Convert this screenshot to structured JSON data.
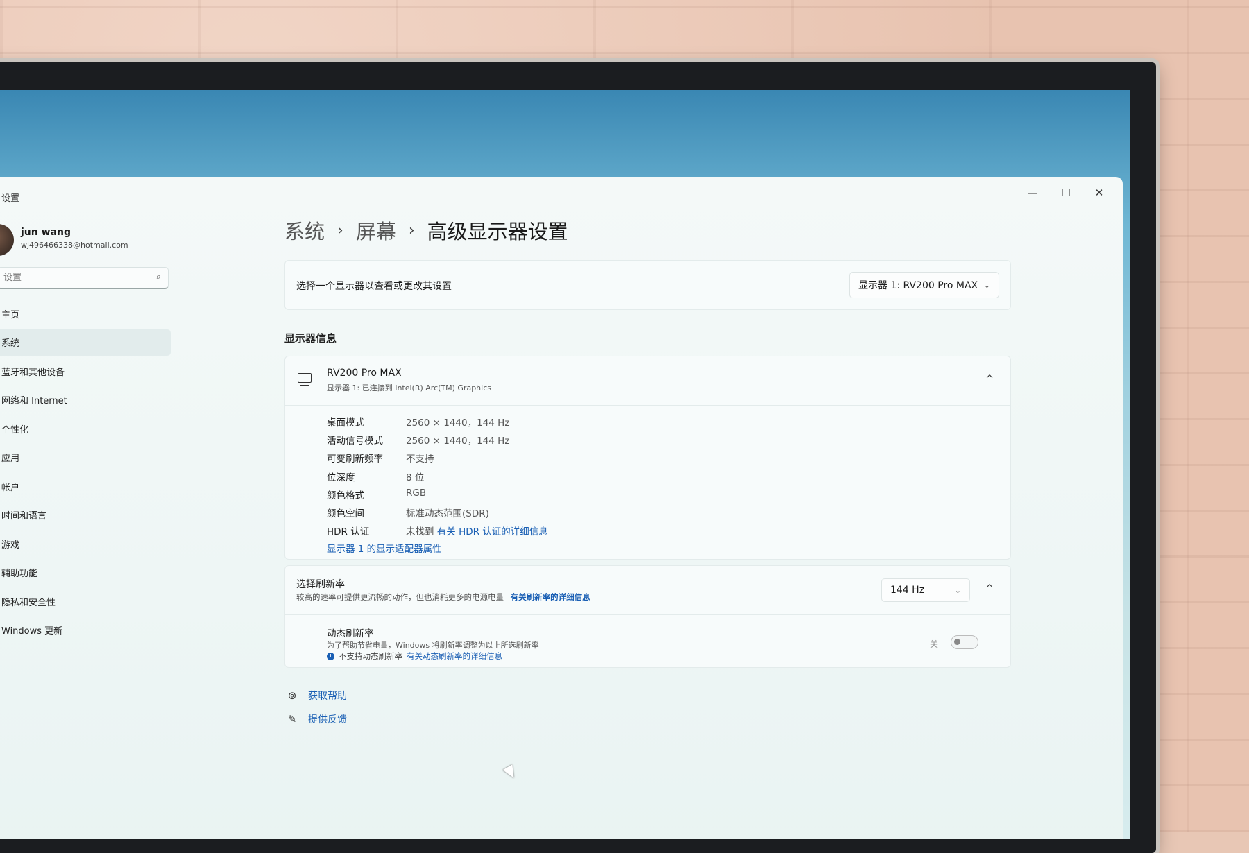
{
  "window": {
    "title": "设置",
    "controls": {
      "minimize": "—",
      "maximize": "☐",
      "close": "✕"
    }
  },
  "user": {
    "name": "jun wang",
    "email": "wj496466338@hotmail.com"
  },
  "search": {
    "placeholder": "设置",
    "icon": "search-icon"
  },
  "sidebar": {
    "items": [
      {
        "label": "主页"
      },
      {
        "label": "系统",
        "active": true
      },
      {
        "label": "蓝牙和其他设备"
      },
      {
        "label": "网络和 Internet"
      },
      {
        "label": "个性化"
      },
      {
        "label": "应用"
      },
      {
        "label": "帐户"
      },
      {
        "label": "时间和语言"
      },
      {
        "label": "游戏"
      },
      {
        "label": "辅助功能"
      },
      {
        "label": "隐私和安全性"
      },
      {
        "label": "Windows 更新"
      }
    ]
  },
  "breadcrumb": {
    "system": "系统",
    "screen": "屏幕",
    "current": "高级显示器设置",
    "separator": "›"
  },
  "display_picker": {
    "label": "选择一个显示器以查看或更改其设置",
    "value": "显示器 1: RV200 Pro MAX"
  },
  "section_title": "显示器信息",
  "display_info": {
    "name": "RV200 Pro MAX",
    "subtitle": "显示器 1: 已连接到 Intel(R) Arc(TM) Graphics",
    "rows": [
      {
        "key": "桌面模式",
        "value": "2560 × 1440，144 Hz"
      },
      {
        "key": "活动信号模式",
        "value": "2560 × 1440，144 Hz"
      },
      {
        "key": "可变刷新频率",
        "value": "不支持"
      },
      {
        "key": "位深度",
        "value": "8 位"
      },
      {
        "key": "颜色格式",
        "value": "RGB"
      },
      {
        "key": "颜色空间",
        "value": "标准动态范围(SDR)"
      },
      {
        "key": "HDR 认证",
        "value": "未找到",
        "link": "有关 HDR 认证的详细信息"
      }
    ],
    "adapter_link": "显示器 1 的显示适配器属性"
  },
  "refresh_rate": {
    "title": "选择刷新率",
    "desc": "较高的速率可提供更流畅的动作，但也消耗更多的电源电量",
    "desc_link": "有关刷新率的详细信息",
    "value": "144 Hz",
    "dynamic_title": "动态刷新率",
    "dynamic_desc": "为了帮助节省电量，Windows 将刷新率调整为以上所选刷新率",
    "dynamic_note": "不支持动态刷新率",
    "dynamic_link": "有关动态刷新率的详细信息",
    "toggle_label": "关",
    "toggle_on": false
  },
  "help": {
    "get_help": "获取帮助",
    "feedback": "提供反馈"
  }
}
